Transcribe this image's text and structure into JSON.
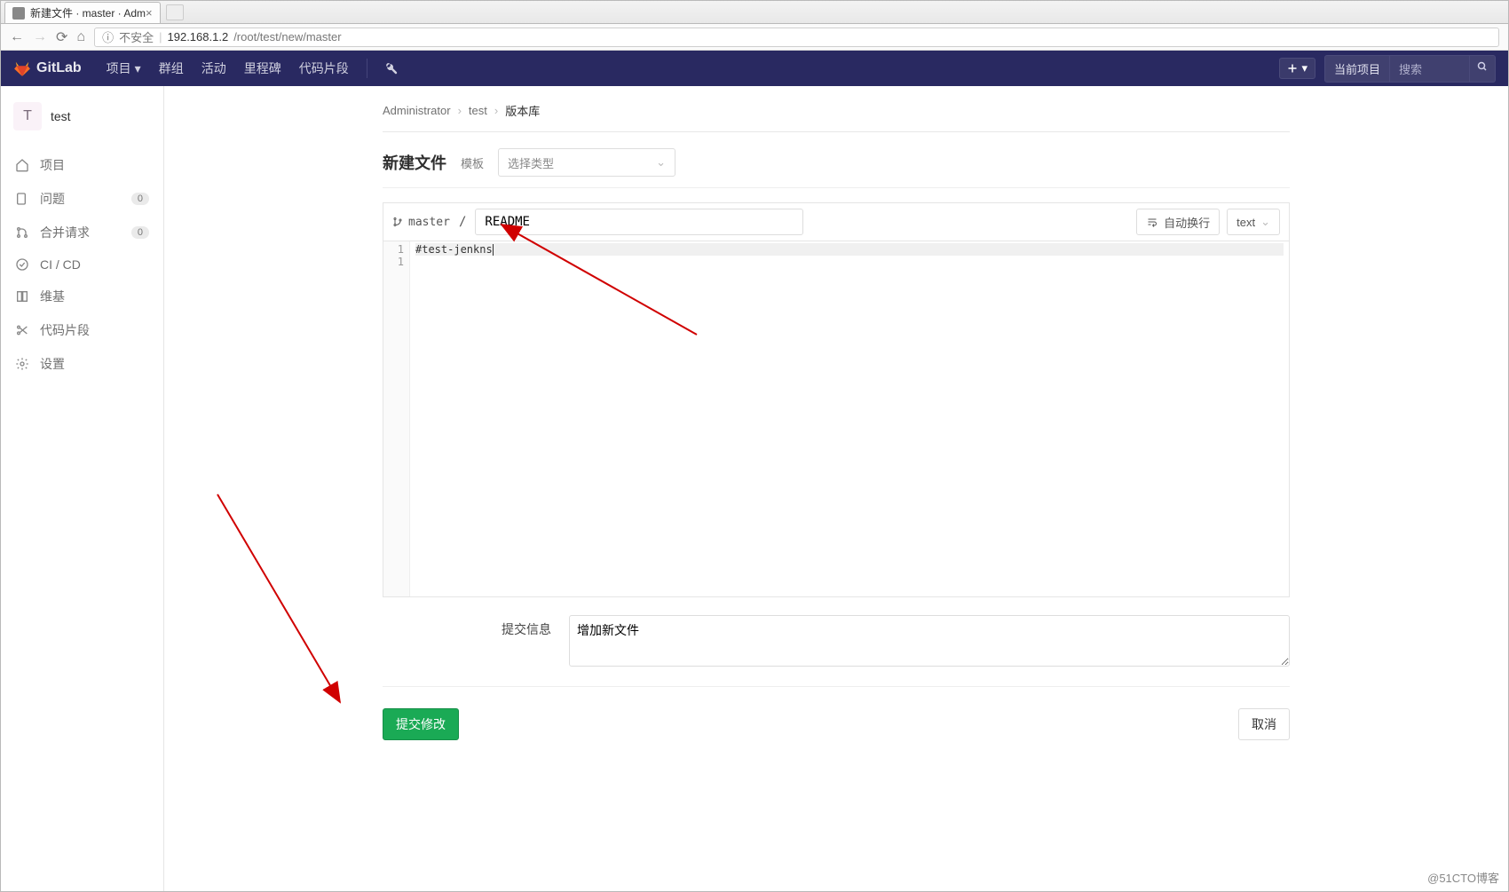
{
  "browser": {
    "tab_title": "新建文件 · master · Adm",
    "security_label": "不安全",
    "url_host": "192.168.1.2",
    "url_path": "/root/test/new/master"
  },
  "navbar": {
    "brand": "GitLab",
    "items": [
      "项目",
      "群组",
      "活动",
      "里程碑",
      "代码片段"
    ],
    "plus_caret": "▾",
    "current_project": "当前项目",
    "search_placeholder": "搜索"
  },
  "sidebar": {
    "project_letter": "T",
    "project_name": "test",
    "items": [
      {
        "label": "项目",
        "icon": "home",
        "badge": null
      },
      {
        "label": "问题",
        "icon": "issue",
        "badge": "0"
      },
      {
        "label": "合并请求",
        "icon": "merge",
        "badge": "0"
      },
      {
        "label": "CI / CD",
        "icon": "cicd",
        "badge": null
      },
      {
        "label": "维基",
        "icon": "book",
        "badge": null
      },
      {
        "label": "代码片段",
        "icon": "scissors",
        "badge": null
      },
      {
        "label": "设置",
        "icon": "gear",
        "badge": null
      }
    ]
  },
  "breadcrumb": {
    "items": [
      "Administrator",
      "test",
      "版本库"
    ]
  },
  "page": {
    "title": "新建文件",
    "template_label": "模板",
    "template_placeholder": "选择类型",
    "branch": "master",
    "filename": "README",
    "wrap_label": "自动换行",
    "lang": "text",
    "code_line1": "#test-jenkns",
    "commit_label": "提交信息",
    "commit_message": "增加新文件",
    "submit_label": "提交修改",
    "cancel_label": "取消"
  },
  "watermark": "@51CTO博客"
}
